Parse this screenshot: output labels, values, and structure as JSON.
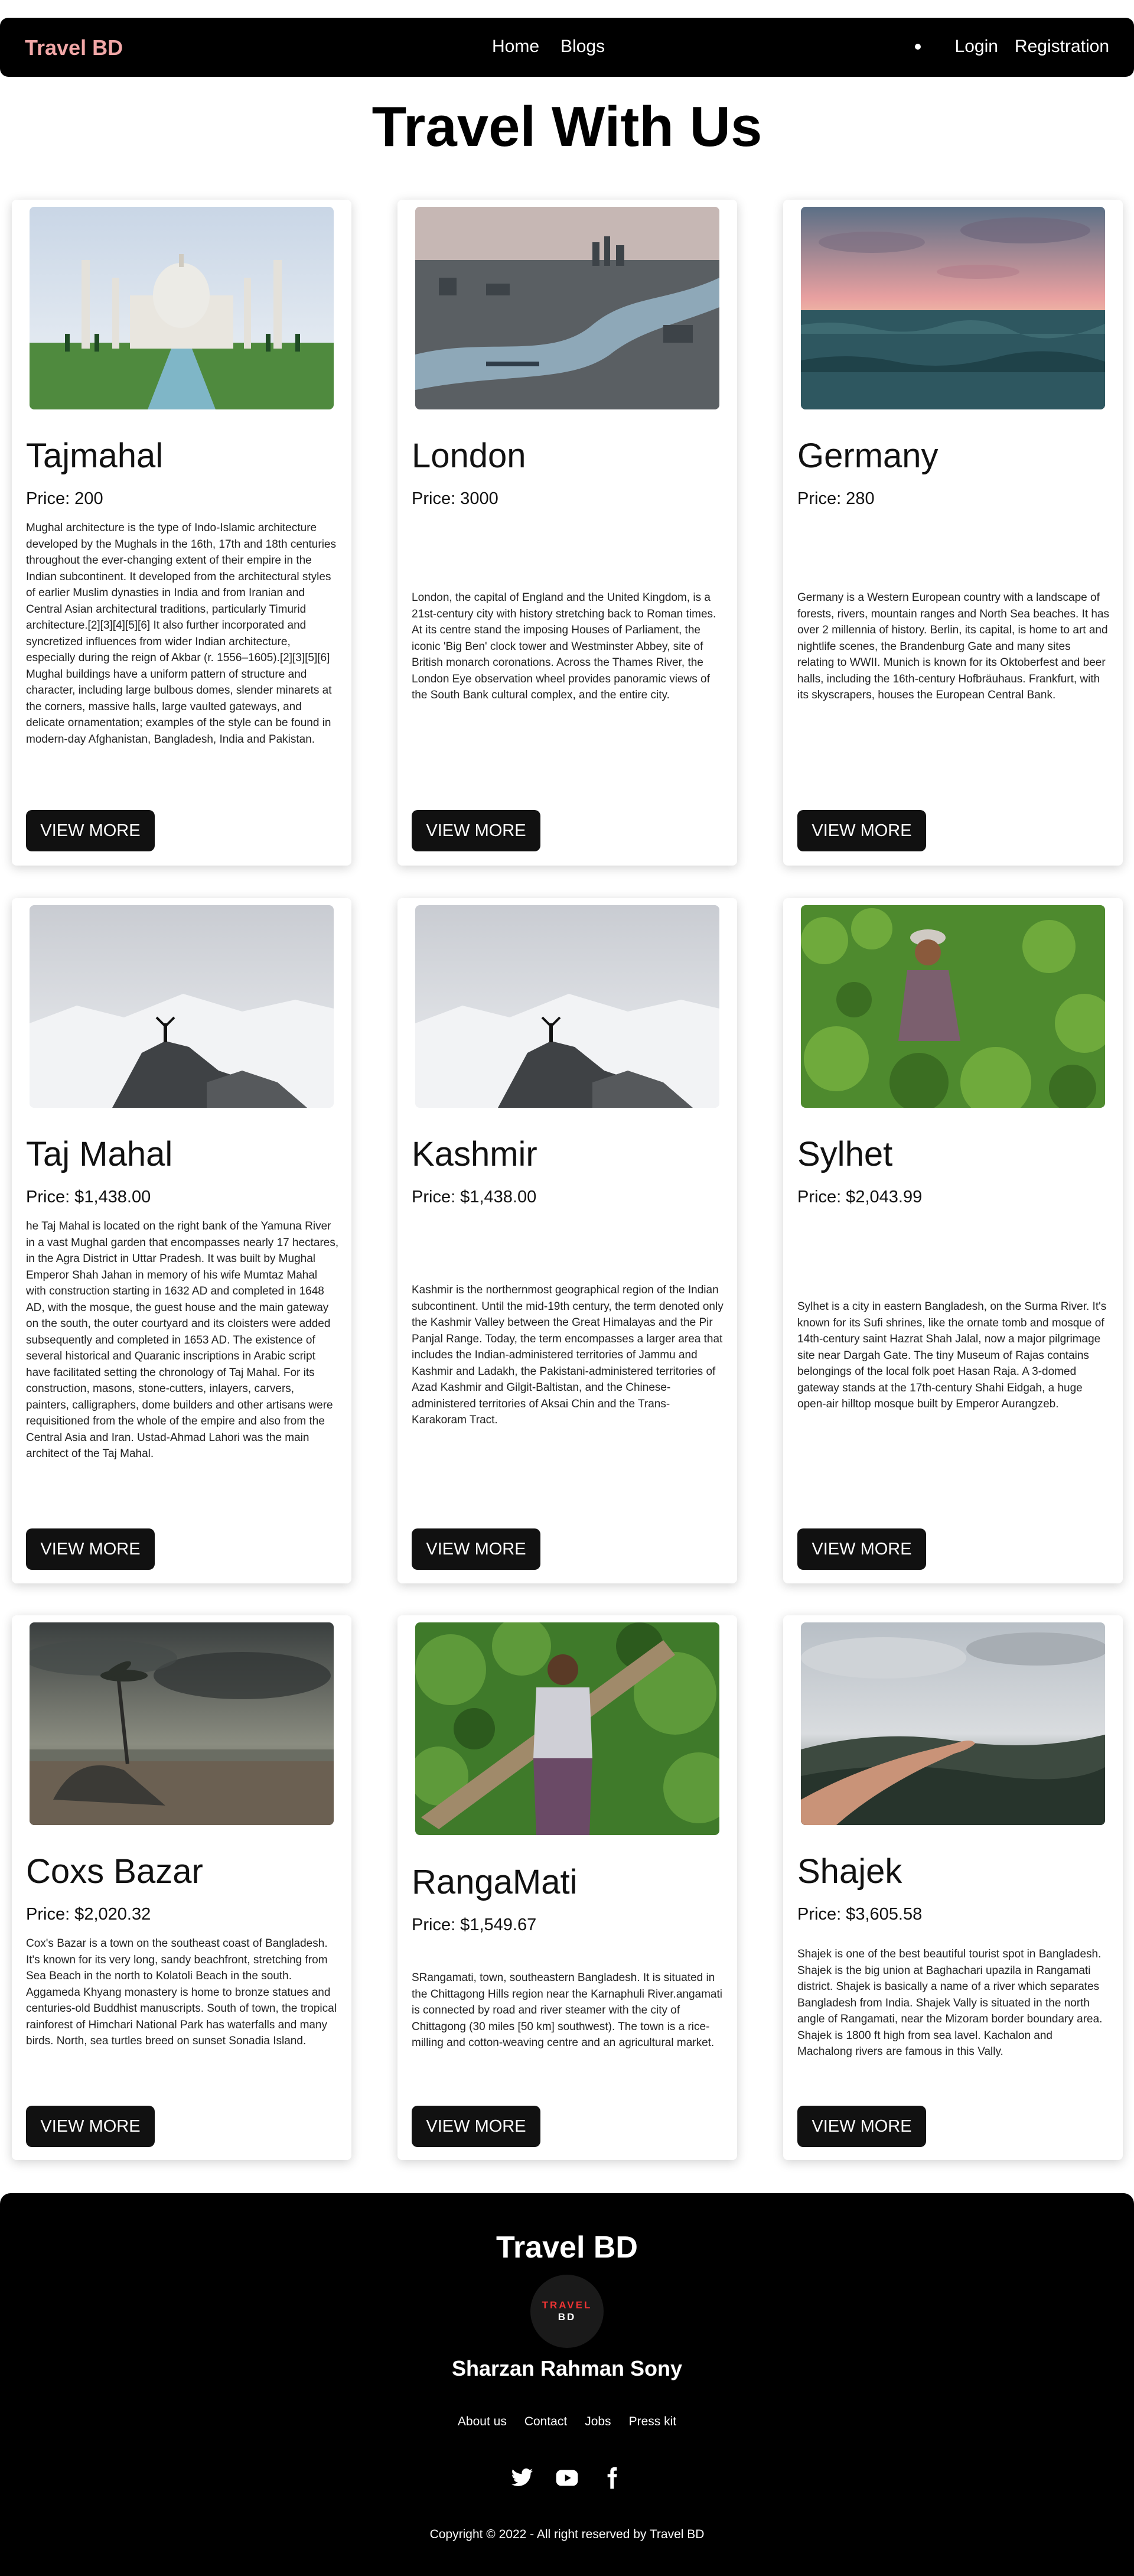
{
  "nav": {
    "brand": "Travel BD",
    "links": [
      "Home",
      "Blogs"
    ],
    "login": "Login",
    "registration": "Registration"
  },
  "page_title": "Travel With Us",
  "button_label": "VIEW MORE",
  "cards": [
    {
      "title": "Tajmahal",
      "price": "Price: 200",
      "image": "taj-mahal-photo",
      "description": "Mughal architecture is the type of Indo-Islamic architecture developed by the Mughals in the 16th, 17th and 18th centuries throughout the ever-changing extent of their empire in the Indian subcontinent. It developed from the architectural styles of earlier Muslim dynasties in India and from Iranian and Central Asian architectural traditions, particularly Timurid architecture.[2][3][4][5][6] It also further incorporated and syncretized influences from wider Indian architecture, especially during the reign of Akbar (r. 1556–1605).[2][3][5][6] Mughal buildings have a uniform pattern of structure and character, including large bulbous domes, slender minarets at the corners, massive halls, large vaulted gateways, and delicate ornamentation; examples of the style can be found in modern-day Afghanistan, Bangladesh, India and Pakistan."
    },
    {
      "title": "London",
      "price": "Price: 3000",
      "image": "london-aerial-photo",
      "description": "London, the capital of England and the United Kingdom, is a 21st-century city with history stretching back to Roman times. At its centre stand the imposing Houses of Parliament, the iconic 'Big Ben' clock tower and Westminster Abbey, site of British monarch coronations. Across the Thames River, the London Eye observation wheel provides panoramic views of the South Bank cultural complex, and the entire city."
    },
    {
      "title": "Germany",
      "price": "Price: 280",
      "image": "sea-sunset-photo",
      "description": "Germany is a Western European country with a landscape of forests, rivers, mountain ranges and North Sea beaches. It has over 2 millennia of history. Berlin, its capital, is home to art and nightlife scenes, the Brandenburg Gate and many sites relating to WWII. Munich is known for its Oktoberfest and beer halls, including the 16th-century Hofbräuhaus. Frankfurt, with its skyscrapers, houses the European Central Bank."
    },
    {
      "title": "Taj Mahal",
      "price": "Price: $1,438.00",
      "image": "snowy-mountain-photo",
      "description": "he Taj Mahal is located on the right bank of the Yamuna River in a vast Mughal garden that encompasses nearly 17 hectares, in the Agra District in Uttar Pradesh. It was built by Mughal Emperor Shah Jahan in memory of his wife Mumtaz Mahal with construction starting in 1632 AD and completed in 1648 AD, with the mosque, the guest house and the main gateway on the south, the outer courtyard and its cloisters were added subsequently and completed in 1653 AD. The existence of several historical and Quaranic inscriptions in Arabic script have facilitated setting the chronology of Taj Mahal. For its construction, masons, stone-cutters, inlayers, carvers, painters, calligraphers, dome builders and other artisans were requisitioned from the whole of the empire and also from the Central Asia and Iran. Ustad-Ahmad Lahori was the main architect of the Taj Mahal."
    },
    {
      "title": "Kashmir",
      "price": "Price: $1,438.00",
      "image": "snowy-mountain-photo",
      "description": "Kashmir is the northernmost geographical region of the Indian subcontinent. Until the mid-19th century, the term denoted only the Kashmir Valley between the Great Himalayas and the Pir Panjal Range. Today, the term encompasses a larger area that includes the Indian-administered territories of Jammu and Kashmir and Ladakh, the Pakistani-administered territories of Azad Kashmir and Gilgit-Baltistan, and the Chinese-administered territories of Aksai Chin and the Trans-Karakoram Tract."
    },
    {
      "title": "Sylhet",
      "price": "Price: $2,043.99",
      "image": "tea-garden-photo",
      "description": "Sylhet is a city in eastern Bangladesh, on the Surma River. It's known for its Sufi shrines, like the ornate tomb and mosque of 14th-century saint Hazrat Shah Jalal, now a major pilgrimage site near Dargah Gate. The tiny Museum of Rajas contains belongings of the local folk poet Hasan Raja. A 3-domed gateway stands at the 17th-century Shahi Eidgah, a huge open-air hilltop mosque built by Emperor Aurangzeb."
    },
    {
      "title": "Coxs Bazar",
      "price": "Price: $2,020.32",
      "image": "beach-boat-photo",
      "description": "Cox's Bazar is a town on the southeast coast of Bangladesh. It's known for its very long, sandy beachfront, stretching from Sea Beach in the north to Kolatoli Beach in the south. Aggameda Khyang monastery is home to bronze statues and centuries-old Buddhist manuscripts. South of town, the tropical rainforest of Himchari National Park has waterfalls and many birds. North, sea turtles breed on sunset Sonadia Island."
    },
    {
      "title": "RangaMati",
      "price": "Price: $1,549.67",
      "image": "man-carrying-log-photo",
      "description": "SRangamati, town, southeastern Bangladesh. It is situated in the Chittagong Hills region near the Karnaphuli River.angamati is connected by road and river steamer with the city of Chittagong (30 miles [50 km] southwest). The town is a rice-milling and cotton-weaving centre and an agricultural market."
    },
    {
      "title": "Shajek",
      "price": "Price: $3,605.58",
      "image": "hand-over-valley-photo",
      "description": "Shajek is one of the best beautiful tourist spot in Bangladesh. Shajek is the big union at Baghachari upazila in Rangamati district. Shajek is basically a name of a river which separates Bangladesh from India. Shajek Vally is situated in the north angle of Rangamati, near the Mizoram border boundary area. Shajek is 1800 ft high from sea lavel. Kachalon and Machalong rivers are famous in this Vally."
    }
  ],
  "footer": {
    "title": "Travel BD",
    "logo_top": "TRAVEL",
    "logo_bottom": "BD",
    "author": "Sharzan Rahman Sony",
    "links": [
      "About us",
      "Contact",
      "Jobs",
      "Press kit"
    ],
    "social": [
      "twitter-icon",
      "youtube-icon",
      "facebook-icon"
    ],
    "copyright": "Copyright © 2022 - All right reserved by Travel BD"
  }
}
